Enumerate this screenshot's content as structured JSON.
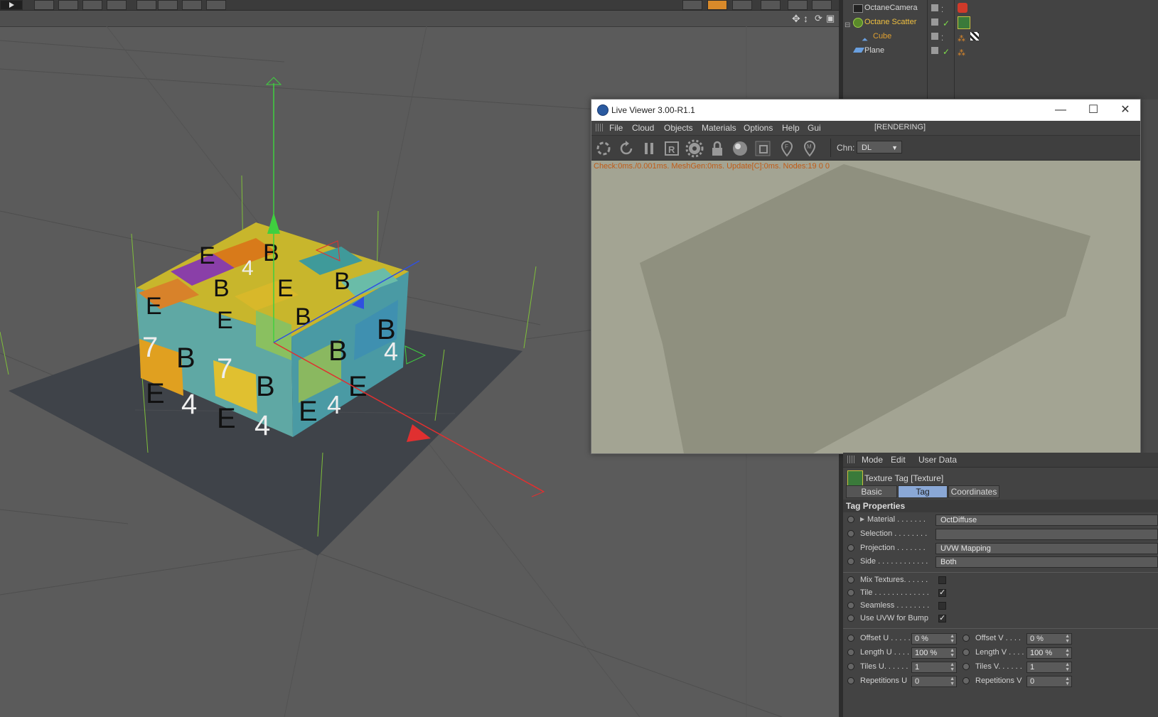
{
  "object_manager": {
    "objects": [
      {
        "name": "OctaneCamera"
      },
      {
        "name": "Octane Scatter"
      },
      {
        "name": "Cube"
      },
      {
        "name": "Plane"
      }
    ]
  },
  "live_viewer": {
    "title": "Live Viewer 3.00-R1.1",
    "menu": [
      "File",
      "Cloud",
      "Objects",
      "Materials",
      "Options",
      "Help",
      "Gui"
    ],
    "render_state": "[RENDERING]",
    "channel_label": "Chn:",
    "channel_value": "DL",
    "status": "Check:0ms./0.001ms. MeshGen:0ms. Update[C]:0ms. Nodes:19  0 0",
    "window_buttons": {
      "minimize": "—",
      "maximize": "☐",
      "close": "✕"
    }
  },
  "attribute_manager": {
    "menu": [
      "Mode",
      "Edit",
      "User Data"
    ],
    "title": "Texture Tag [Texture]",
    "tabs": [
      "Basic",
      "Tag",
      "Coordinates"
    ],
    "active_tab": "Tag",
    "section": "Tag Properties",
    "properties": [
      {
        "label": "Material . . . . . . .",
        "value": "OctDiffuse"
      },
      {
        "label": "Selection . . . . . . . .",
        "value": ""
      },
      {
        "label": "Projection  . . . . . . .",
        "value": "UVW Mapping"
      },
      {
        "label": "Side . . . . . . . . . . . .",
        "value": "Both"
      }
    ],
    "checkboxes": [
      {
        "label": "Mix Textures. . . . . .",
        "checked": false
      },
      {
        "label": "Tile . . . . . . . . . . . . .",
        "checked": true
      },
      {
        "label": "Seamless  . . . . . . . .",
        "checked": false
      },
      {
        "label": "Use UVW for Bump",
        "checked": true
      }
    ],
    "numeric": [
      {
        "left_label": "Offset U . . . . .",
        "left_value": "0 %",
        "right_label": "Offset V . . . .",
        "right_value": "0 %"
      },
      {
        "left_label": "Length U . . . .",
        "left_value": "100 %",
        "right_label": "Length V . . . .",
        "right_value": "100 %"
      },
      {
        "left_label": "Tiles U. . . . . .",
        "left_value": "1",
        "right_label": "Tiles V. . . . . .",
        "right_value": "1"
      },
      {
        "left_label": "Repetitions U",
        "left_value": "0",
        "right_label": "Repetitions V",
        "right_value": "0"
      }
    ]
  },
  "cube_texture_glyphs": [
    "7",
    "B",
    "E",
    "4"
  ],
  "colors": {
    "accent_tab": "#8aa8d6",
    "status_orange": "#c15b16",
    "scatter_name": "#f0c040",
    "cube_name": "#e0a030",
    "render_bg": "#a3a493",
    "render_plane": "#8f907f"
  }
}
